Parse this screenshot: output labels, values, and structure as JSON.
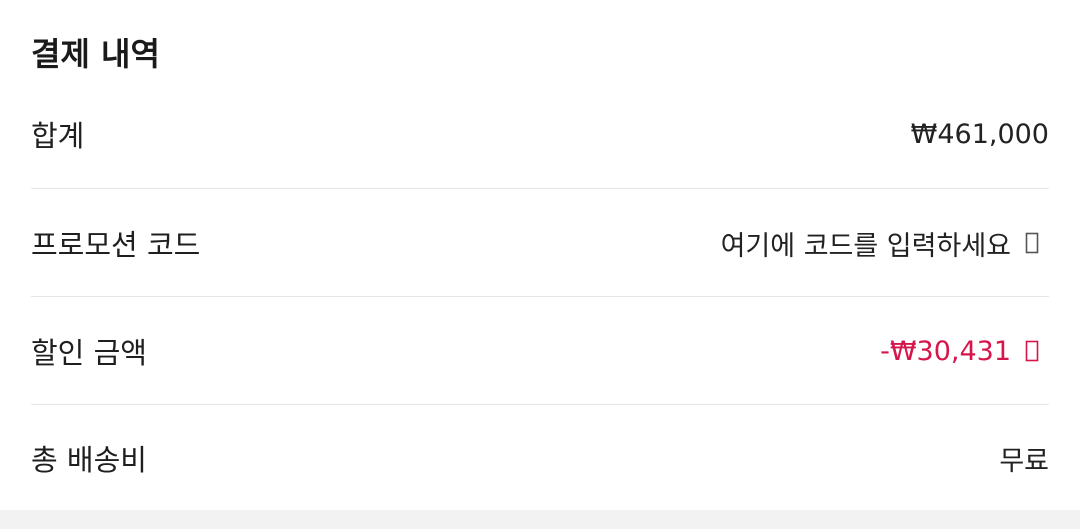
{
  "section": {
    "title": "결제 내역"
  },
  "rows": [
    {
      "label": "합계",
      "value": "₩461,000"
    },
    {
      "label": "프로모션 코드",
      "value": "여기에 코드를 입력하세요"
    },
    {
      "label": "할인 금액",
      "value": "-₩30,431"
    },
    {
      "label": "총 배송비",
      "value": "무료"
    }
  ],
  "icons": {
    "promo_chevron": "chevron-right-icon",
    "discount_chevron": "chevron-right-icon"
  },
  "colors": {
    "discount": "#d6154a",
    "divider": "#e6e6e6"
  }
}
